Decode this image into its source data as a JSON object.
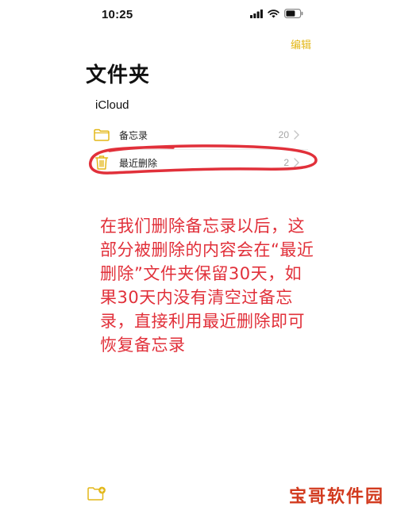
{
  "status_bar": {
    "time": "10:25",
    "icons": [
      "signal-icon",
      "wifi-icon",
      "battery-icon"
    ]
  },
  "nav": {
    "edit_label": "编辑"
  },
  "page": {
    "title": "文件夹"
  },
  "section": {
    "title": "iCloud"
  },
  "folders": [
    {
      "icon": "folder-icon",
      "label": "备忘录",
      "count": "20"
    },
    {
      "icon": "trash-icon",
      "label": "最近删除",
      "count": "2"
    }
  ],
  "annotation": {
    "text": "在我们删除备忘录以后，这部分被删除的内容会在“最近删除”文件夹保留30天，如果30天内没有清空过备忘录，直接利用最近删除即可恢复备忘录"
  },
  "toolbar": {
    "new_folder_icon": "new-folder-icon"
  },
  "watermark": {
    "text": "宝哥软件园"
  },
  "colors": {
    "accent": "#e3b718",
    "annotation": "#e1303a",
    "watermark": "#d23a1e"
  }
}
